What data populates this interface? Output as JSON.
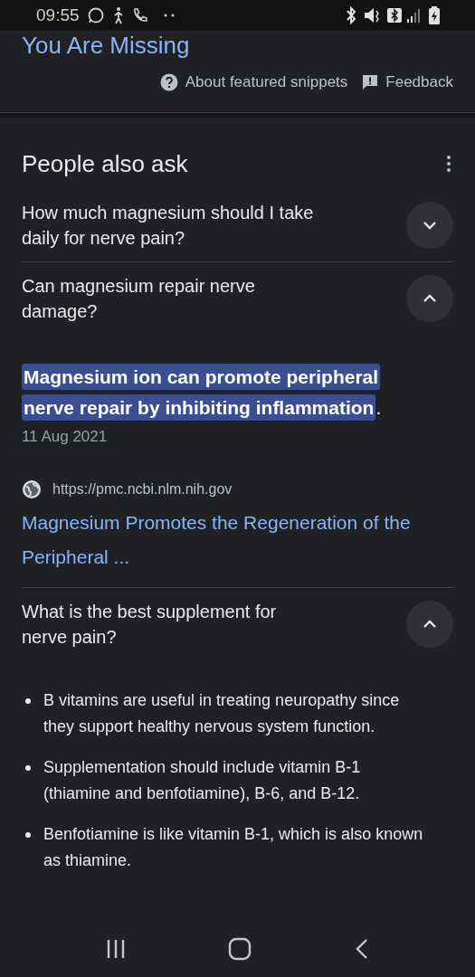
{
  "status_bar": {
    "time": "09:55"
  },
  "title_link": "You Are Missing",
  "snippet_links": [
    {
      "kind": "help",
      "label": "About featured snippets"
    },
    {
      "kind": "feedback",
      "label": "Feedback"
    }
  ],
  "people_also_ask": {
    "heading": "People also ask",
    "questions": [
      {
        "question": "How much magnesium should I take daily for nerve pain?",
        "expanded": false
      },
      {
        "question": "Can magnesium repair nerve damage?",
        "expanded": true,
        "answer": {
          "kind": "snippet",
          "highlight": "Magnesium ion can promote peripheral nerve repair by inhibiting inflammation",
          "trailing": ".",
          "date": "11 Aug 2021",
          "source_url": "https://pmc.ncbi.nlm.nih.gov",
          "result_title": "Magnesium Promotes the Regeneration of the Peripheral ..."
        }
      },
      {
        "question": "What is the best supplement for nerve pain?",
        "expanded": true,
        "answer": {
          "kind": "bullets",
          "items": [
            "B vitamins are useful in treating neuropathy since they support healthy nervous system function.",
            "Supplementation should include vitamin B-1 (thiamine and benfotiamine), B-6, and B-12.",
            "Benfotiamine is like vitamin B-1, which is also known as thiamine."
          ]
        }
      }
    ]
  }
}
